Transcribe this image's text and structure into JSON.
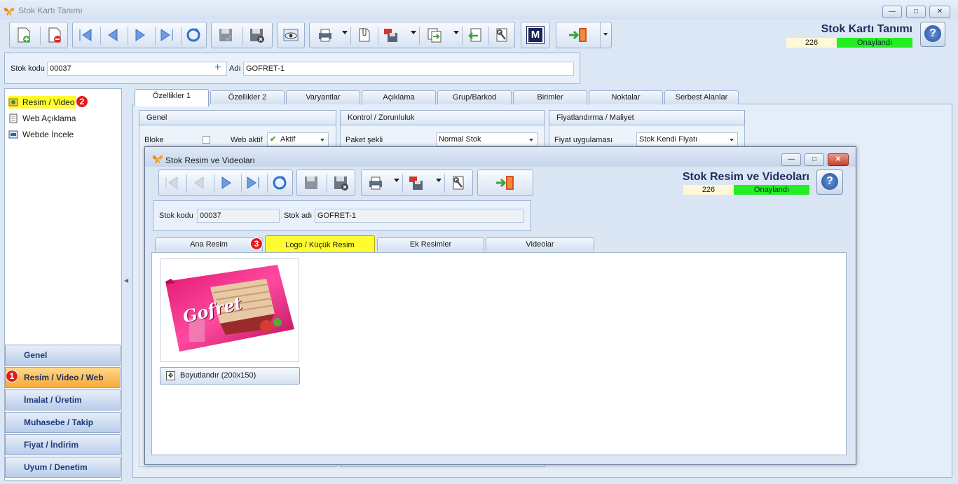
{
  "main_window": {
    "title": "Stok Kartı Tanımı",
    "header_title": "Stok Kartı Tanımı",
    "record_number": "226",
    "status": "Onaylandı",
    "stock_code_label": "Stok kodu",
    "stock_code": "00037",
    "name_label": "Adı",
    "name": "GOFRET-1",
    "toolbar": {
      "m_button_label": "M"
    },
    "tabs": [
      {
        "label": "Özellikler 1"
      },
      {
        "label": "Özellikler 2"
      },
      {
        "label": "Varyantlar"
      },
      {
        "label": "Açıklama"
      },
      {
        "label": "Grup/Barkod"
      },
      {
        "label": "Birimler"
      },
      {
        "label": "Noktalar"
      },
      {
        "label": "Serbest Alanlar"
      }
    ],
    "groups": {
      "genel": {
        "title": "Genel",
        "bloke_label": "Bloke",
        "web_aktif_label": "Web aktif",
        "web_aktif_value": "Aktif"
      },
      "kontrol": {
        "title": "Kontrol / Zorunluluk",
        "paket_label": "Paket şekli",
        "paket_value": "Normal Stok"
      },
      "fiyat": {
        "title": "Fiyatlandırma / Maliyet",
        "uygulama_label": "Fiyat uygulaması",
        "uygulama_value": "Stok Kendi Fiyatı"
      }
    }
  },
  "sidebar": {
    "items": [
      {
        "label": "Resim / Video",
        "icon": "image-icon"
      },
      {
        "label": "Web Açıklama",
        "icon": "document-icon"
      },
      {
        "label": "Webde İncele",
        "icon": "web-preview-icon"
      }
    ],
    "badges": {
      "resim_video": "2",
      "nav": "1",
      "sub_tab": "3"
    },
    "nav": [
      {
        "label": "Genel"
      },
      {
        "label": "Resim / Video / Web"
      },
      {
        "label": "İmalat / Üretim"
      },
      {
        "label": "Muhasebe / Takip"
      },
      {
        "label": "Fiyat / İndirim"
      },
      {
        "label": "Uyum / Denetim"
      }
    ]
  },
  "dialog": {
    "title": "Stok Resim ve Videoları",
    "header_title": "Stok Resim ve Videoları",
    "record_number": "226",
    "status": "Onaylandı",
    "stock_code_label": "Stok kodu",
    "stock_code": "00037",
    "stock_name_label": "Stok adı",
    "stock_name": "GOFRET-1",
    "tabs": [
      {
        "label": "Ana Resim"
      },
      {
        "label": "Logo / Küçük Resim"
      },
      {
        "label": "Ek Resimler"
      },
      {
        "label": "Videolar"
      }
    ],
    "image_brand": "Gofret",
    "resize_button": "Boyutlandır (200x150)"
  },
  "colors": {
    "status_green": "#22ee22",
    "highlight_yellow": "#fffd2f",
    "nav_active_orange": "#f7a938",
    "title_navy": "#1f2d5c"
  }
}
